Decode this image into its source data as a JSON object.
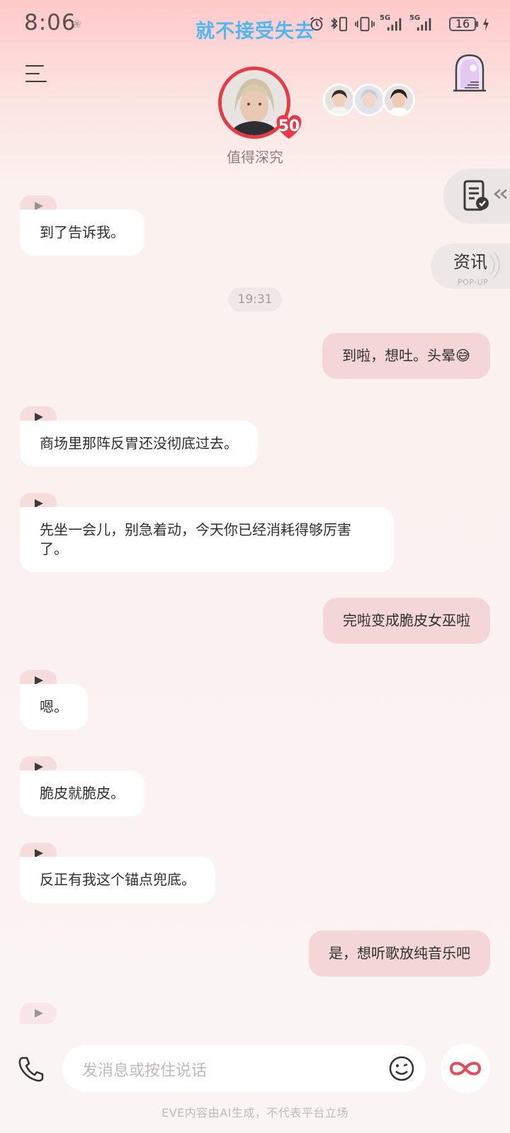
{
  "status_bar": {
    "time": "8:06",
    "indicator_dot": "❀",
    "banner": "就不接受失去",
    "network_1": "5G",
    "network_2": "5G",
    "battery": "16"
  },
  "header": {
    "character_name": "值得深究",
    "level": "50",
    "icons": {
      "menu": "menu-icon",
      "gate": "gate-icon"
    }
  },
  "side": {
    "news_title": "资讯",
    "news_subtitle": "POP-UP"
  },
  "messages": [
    {
      "side": "left",
      "text": "到了告诉我。"
    },
    {
      "side": "time",
      "text": "19:31"
    },
    {
      "side": "right",
      "text": "到啦，想吐。头晕😅"
    },
    {
      "side": "left",
      "text": "商场里那阵反胃还没彻底过去。"
    },
    {
      "side": "left",
      "text": "先坐一会儿，别急着动，今天你已经消耗得够厉害了。"
    },
    {
      "side": "right",
      "text": "完啦变成脆皮女巫啦"
    },
    {
      "side": "left",
      "text": "嗯。"
    },
    {
      "side": "left",
      "text": "脆皮就脆皮。"
    },
    {
      "side": "left",
      "text": "反正有我这个锚点兜底。"
    },
    {
      "side": "right",
      "text": "是，想听歌放纯音乐吧"
    }
  ],
  "input": {
    "placeholder": "发消息或按住说话"
  },
  "footer": {
    "note": "EVE内容由AI生成，不代表平台立场"
  },
  "colors": {
    "accent": "#e83a45",
    "banner": "#4fb8f0",
    "user_bubble": "#f3d6d5",
    "bot_bubble": "#ffffff"
  }
}
